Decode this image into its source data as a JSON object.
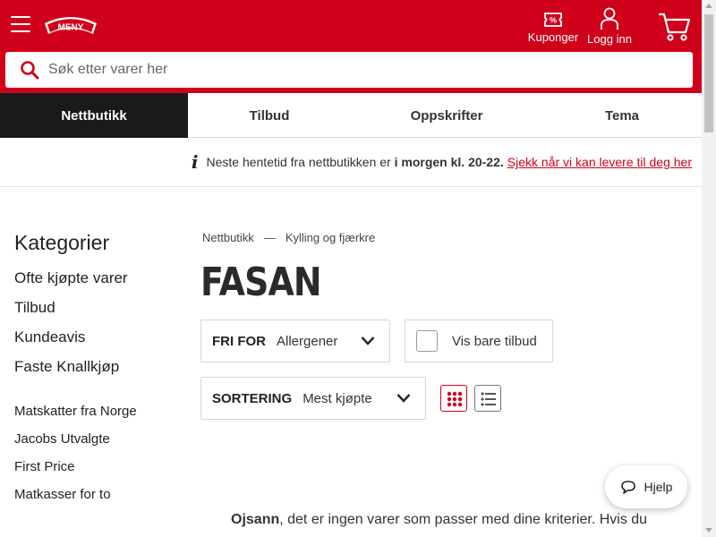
{
  "brand": {
    "logo_text": "MENY",
    "primary_color": "#d0021b"
  },
  "header": {
    "coupons_label": "Kuponger",
    "login_label": "Logg inn",
    "search_placeholder": "Søk etter varer her"
  },
  "nav": {
    "tabs": [
      {
        "label": "Nettbutikk",
        "active": true
      },
      {
        "label": "Tilbud",
        "active": false
      },
      {
        "label": "Oppskrifter",
        "active": false
      },
      {
        "label": "Tema",
        "active": false
      }
    ]
  },
  "info_banner": {
    "icon": "info-icon",
    "icon_glyph": "i",
    "text_before": "Neste hentetid fra nettbutikken er",
    "text_strong": "i morgen kl. 20-22.",
    "link_text": "Sjekk når vi kan levere til deg her"
  },
  "sidebar": {
    "title": "Kategorier",
    "main_items": [
      "Ofte kjøpte varer",
      "Tilbud",
      "Kundeavis",
      "Faste Knallkjøp"
    ],
    "sub_items": [
      "Matskatter fra Norge",
      "Jacobs Utvalgte",
      "First Price",
      "Matkasser for to"
    ]
  },
  "breadcrumb": {
    "items": [
      "Nettbutikk",
      "Kylling og fjærkre"
    ],
    "separator": "—"
  },
  "page_title": "FASAN",
  "filters": {
    "allergen": {
      "key": "FRI FOR",
      "value": "Allergener"
    },
    "offers_only": {
      "label": "Vis bare tilbud",
      "checked": false
    },
    "sort": {
      "key": "SORTERING",
      "value": "Mest kjøpte"
    },
    "view_mode": "grid"
  },
  "empty_message": {
    "strong": "Ojsann",
    "text": ", det er ingen varer som passer med dine kriterier. Hvis du"
  },
  "help": {
    "label": "Hjelp"
  }
}
